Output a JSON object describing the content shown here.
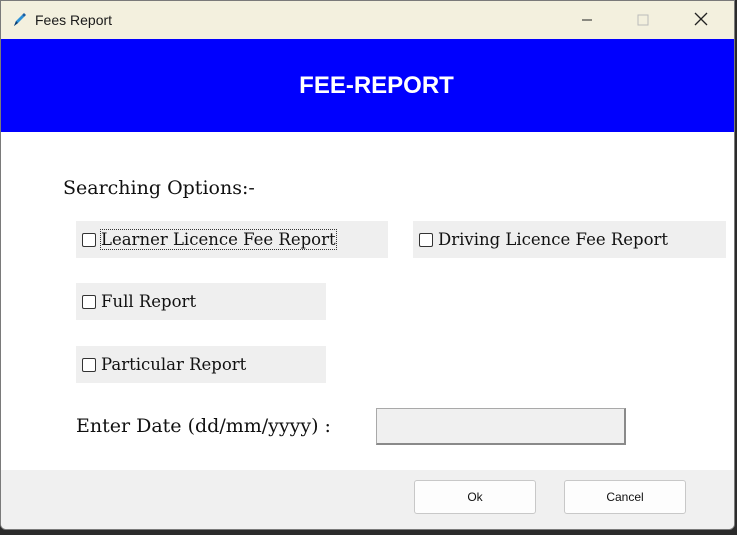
{
  "window": {
    "title": "Fees Report",
    "icon": "app-pen-icon",
    "controls": {
      "minimize": "minimize-icon",
      "maximize": "maximize-icon",
      "close": "close-icon"
    }
  },
  "banner": {
    "title": "FEE-REPORT",
    "color": "#0000fe"
  },
  "search": {
    "label": "Searching Options:-",
    "options": [
      {
        "label": "Learner Licence Fee Report",
        "checked": false
      },
      {
        "label": "Driving Licence Fee Report",
        "checked": false
      },
      {
        "label": "Full Report",
        "checked": false
      },
      {
        "label": "Particular Report",
        "checked": false
      }
    ]
  },
  "date": {
    "label": "Enter Date (dd/mm/yyyy) :",
    "value": ""
  },
  "footer": {
    "ok_label": "Ok",
    "cancel_label": "Cancel"
  }
}
